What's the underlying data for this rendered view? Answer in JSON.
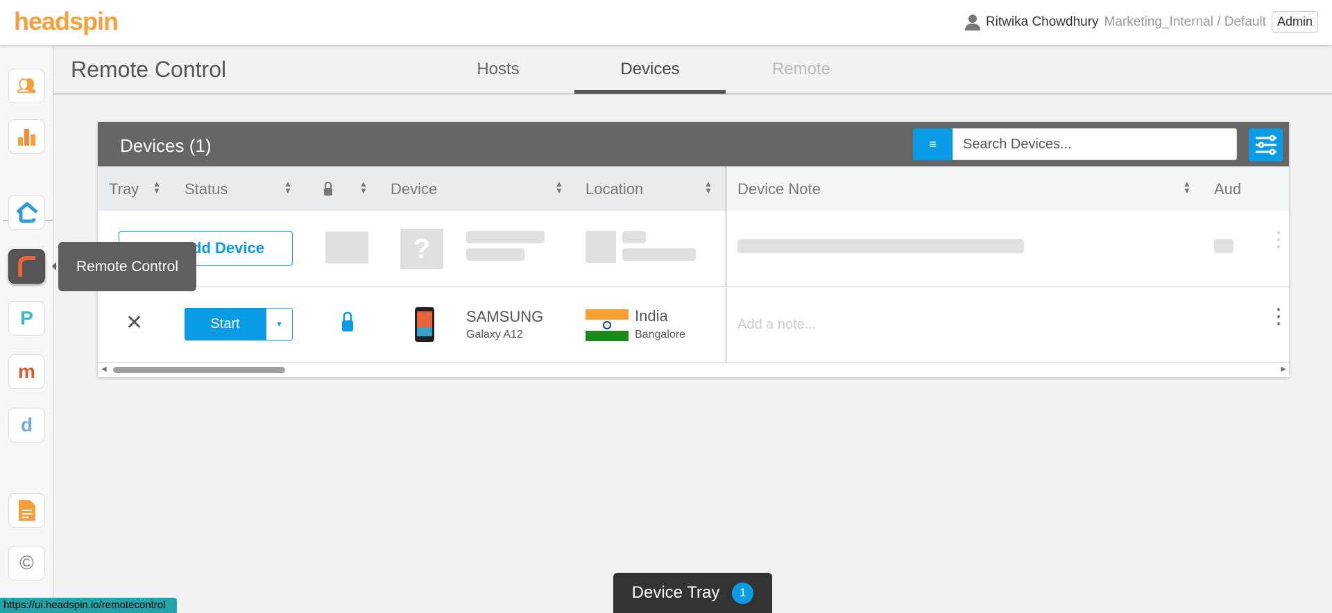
{
  "header": {
    "logo": "headspin",
    "user_name": "Ritwika Chowdhury",
    "org": "Marketing_Internal / Default",
    "role_button": "Admin"
  },
  "sidebar": {
    "items": [
      {
        "icon": "team-icon"
      },
      {
        "icon": "analytics-icon"
      },
      {
        "icon": "home-icon"
      },
      {
        "icon": "remote-control-icon",
        "active": true
      },
      {
        "icon": "p-app-icon"
      },
      {
        "icon": "m-app-icon"
      },
      {
        "icon": "d-app-icon"
      },
      {
        "icon": "document-icon"
      },
      {
        "icon": "copyright-icon"
      }
    ],
    "tooltip": "Remote Control"
  },
  "page": {
    "title": "Remote Control",
    "tabs": [
      {
        "label": "Hosts"
      },
      {
        "label": "Devices",
        "active": true
      },
      {
        "label": "Remote",
        "disabled": true
      }
    ]
  },
  "panel": {
    "title": "Devices (1)",
    "search_placeholder": "Search Devices...",
    "columns": [
      "Tray",
      "Status",
      "",
      "Device",
      "Location",
      "Device Note",
      "Aud"
    ],
    "add_device_label": "Add Device",
    "rows": [
      {
        "status_button": "Start",
        "locked": true,
        "device_brand": "SAMSUNG",
        "device_model": "Galaxy A12",
        "country": "India",
        "city": "Bangalore",
        "note_placeholder": "Add a note..."
      }
    ]
  },
  "device_tray": {
    "label": "Device Tray",
    "count": "1"
  },
  "status_url": "https://ui.headspin.io/remotecontrol",
  "colors": {
    "accent": "#0a9be6",
    "brand": "#f5a03a",
    "panel_header": "#666666"
  }
}
